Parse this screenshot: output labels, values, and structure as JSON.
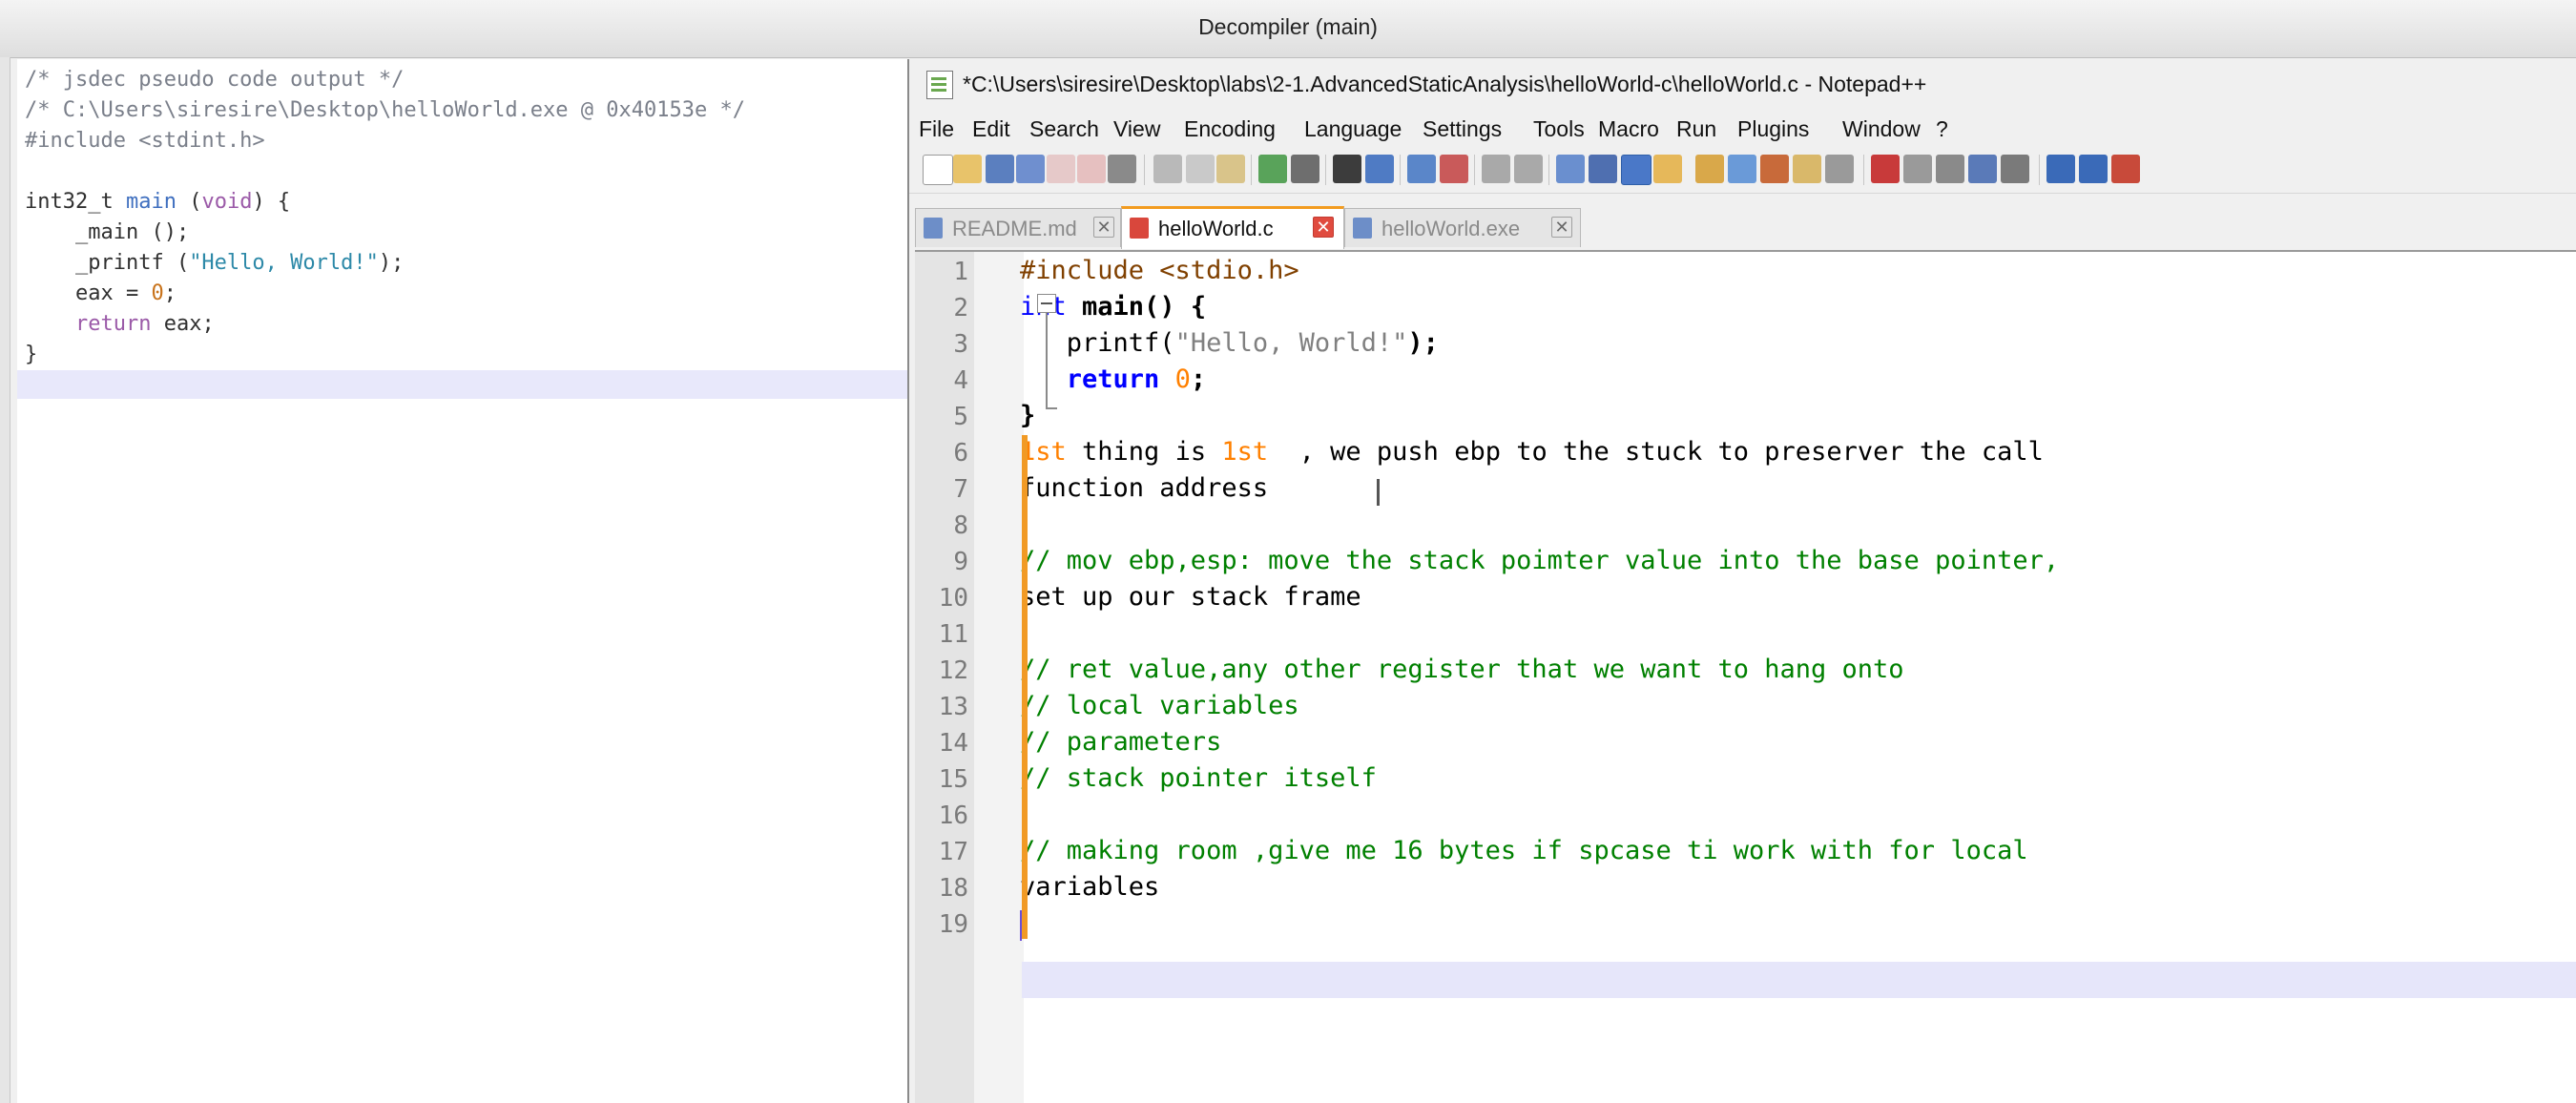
{
  "decompiler": {
    "title": "Decompiler (main)",
    "lines": [
      {
        "parts": [
          {
            "t": "/* jsdec pseudo code output */",
            "c": "c-com"
          }
        ]
      },
      {
        "parts": [
          {
            "t": "/* C:\\Users\\siresire\\Desktop\\helloWorld.exe @ 0x40153e */",
            "c": "c-com"
          }
        ]
      },
      {
        "parts": [
          {
            "t": "#include <stdint.h>",
            "c": "c-com"
          }
        ]
      },
      {
        "parts": []
      },
      {
        "parts": [
          {
            "t": "int32_t ",
            "c": ""
          },
          {
            "t": "main",
            "c": "c-fn"
          },
          {
            "t": " (",
            "c": ""
          },
          {
            "t": "void",
            "c": "c-kw"
          },
          {
            "t": ") {",
            "c": ""
          }
        ]
      },
      {
        "parts": [
          {
            "t": "    _main ();",
            "c": ""
          }
        ]
      },
      {
        "parts": [
          {
            "t": "    _printf (",
            "c": ""
          },
          {
            "t": "\"Hello, World!\"",
            "c": "c-str"
          },
          {
            "t": ");",
            "c": ""
          }
        ]
      },
      {
        "parts": [
          {
            "t": "    eax = ",
            "c": ""
          },
          {
            "t": "0",
            "c": "c-num"
          },
          {
            "t": ";",
            "c": ""
          }
        ]
      },
      {
        "parts": [
          {
            "t": "    ",
            "c": ""
          },
          {
            "t": "return",
            "c": "c-kw"
          },
          {
            "t": " eax;",
            "c": ""
          }
        ]
      },
      {
        "parts": [
          {
            "t": "}",
            "c": ""
          }
        ]
      }
    ]
  },
  "notepad": {
    "title": "*C:\\Users\\siresire\\Desktop\\labs\\2-1.AdvancedStaticAnalysis\\helloWorld-c\\helloWorld.c - Notepad++",
    "menu": [
      "File",
      "Edit",
      "Search",
      "View",
      "Encoding",
      "Language",
      "Settings",
      "Tools",
      "Macro",
      "Run",
      "Plugins",
      "Window",
      "?"
    ],
    "tabs": [
      {
        "label": "README.md",
        "active": false
      },
      {
        "label": "helloWorld.c",
        "active": true
      },
      {
        "label": "helloWorld.exe",
        "active": false
      }
    ],
    "lines": [
      {
        "n": "1",
        "parts": [
          {
            "t": "#include <stdio.h>",
            "c": "n-pre"
          }
        ]
      },
      {
        "n": "2",
        "parts": [
          {
            "t": "int",
            "c": "n-kw"
          },
          {
            "t": " main() {",
            "c": "n-bold"
          }
        ]
      },
      {
        "n": "3",
        "parts": [
          {
            "t": "   printf(",
            "c": ""
          },
          {
            "t": "\"Hello, World!\"",
            "c": "n-str"
          },
          {
            "t": ");",
            "c": "n-bold"
          }
        ]
      },
      {
        "n": "4",
        "parts": [
          {
            "t": "   ",
            "c": ""
          },
          {
            "t": "return",
            "c": "n-kw n-bold"
          },
          {
            "t": " ",
            "c": ""
          },
          {
            "t": "0",
            "c": "n-num"
          },
          {
            "t": ";",
            "c": "n-bold"
          }
        ]
      },
      {
        "n": "5",
        "parts": [
          {
            "t": "}",
            "c": "n-bold"
          }
        ]
      },
      {
        "n": "6",
        "parts": [
          {
            "t": "1st",
            "c": "n-num"
          },
          {
            "t": " thing is ",
            "c": ""
          },
          {
            "t": "1st",
            "c": "n-num"
          },
          {
            "t": "  , we push ebp to the stuck to preserver the call",
            "c": ""
          }
        ]
      },
      {
        "n": "7",
        "parts": [
          {
            "t": "function address",
            "c": ""
          }
        ]
      },
      {
        "n": "8",
        "parts": []
      },
      {
        "n": "9",
        "parts": [
          {
            "t": "// mov ebp,esp: move the stack poimter value into the base pointer,",
            "c": "n-com"
          }
        ]
      },
      {
        "n": "10",
        "parts": [
          {
            "t": "set up our stack frame",
            "c": ""
          }
        ]
      },
      {
        "n": "11",
        "parts": []
      },
      {
        "n": "12",
        "parts": [
          {
            "t": "// ret value,any other register that we want to hang onto",
            "c": "n-com"
          }
        ]
      },
      {
        "n": "13",
        "parts": [
          {
            "t": "// local variables",
            "c": "n-com"
          }
        ]
      },
      {
        "n": "14",
        "parts": [
          {
            "t": "// parameters",
            "c": "n-com"
          }
        ]
      },
      {
        "n": "15",
        "parts": [
          {
            "t": "// stack pointer itself",
            "c": "n-com"
          }
        ]
      },
      {
        "n": "16",
        "parts": []
      },
      {
        "n": "17",
        "parts": [
          {
            "t": "// making room ,give me 16 bytes if spcase ti work with for local",
            "c": "n-com"
          }
        ]
      },
      {
        "n": "18",
        "parts": [
          {
            "t": "variables",
            "c": ""
          }
        ]
      },
      {
        "n": "19",
        "parts": []
      }
    ]
  },
  "colors": {
    "accent": "#f29b1f",
    "tab_close_active": "#e04b3f",
    "comment": "#008000",
    "keyword": "#0000ff"
  }
}
